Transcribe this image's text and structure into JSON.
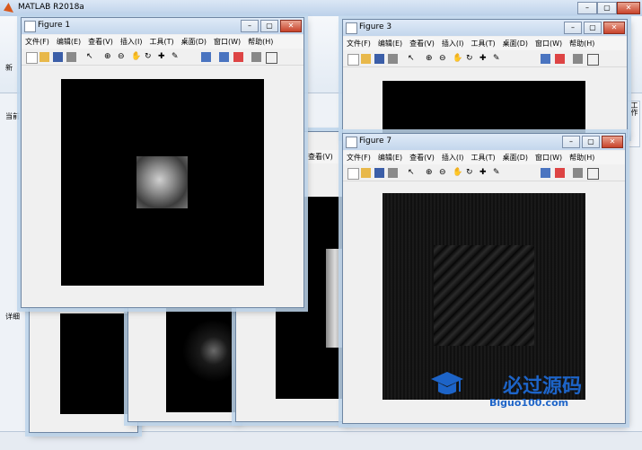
{
  "app": {
    "title": "MATLAB R2018a",
    "side_left": "当前",
    "side_left2": "新",
    "side_left3": "详细",
    "side_right": "工作"
  },
  "menus": [
    "文件(F)",
    "编辑(E)",
    "查看(V)",
    "插入(I)",
    "工具(T)",
    "桌面(D)",
    "窗口(W)",
    "帮助(H)"
  ],
  "figures": {
    "fig1": {
      "title": "Figure 1"
    },
    "fig3": {
      "title": "Figure 3"
    },
    "fig7": {
      "title": "Figure 7"
    }
  },
  "watermark": {
    "brand": "必过源码",
    "domain": "Biguo100.com"
  },
  "colors": {
    "title_bar": "#c3d6ec",
    "canvas": "#000000",
    "window_bg": "#f0f0f0",
    "brand_blue": "#1d64c8"
  }
}
